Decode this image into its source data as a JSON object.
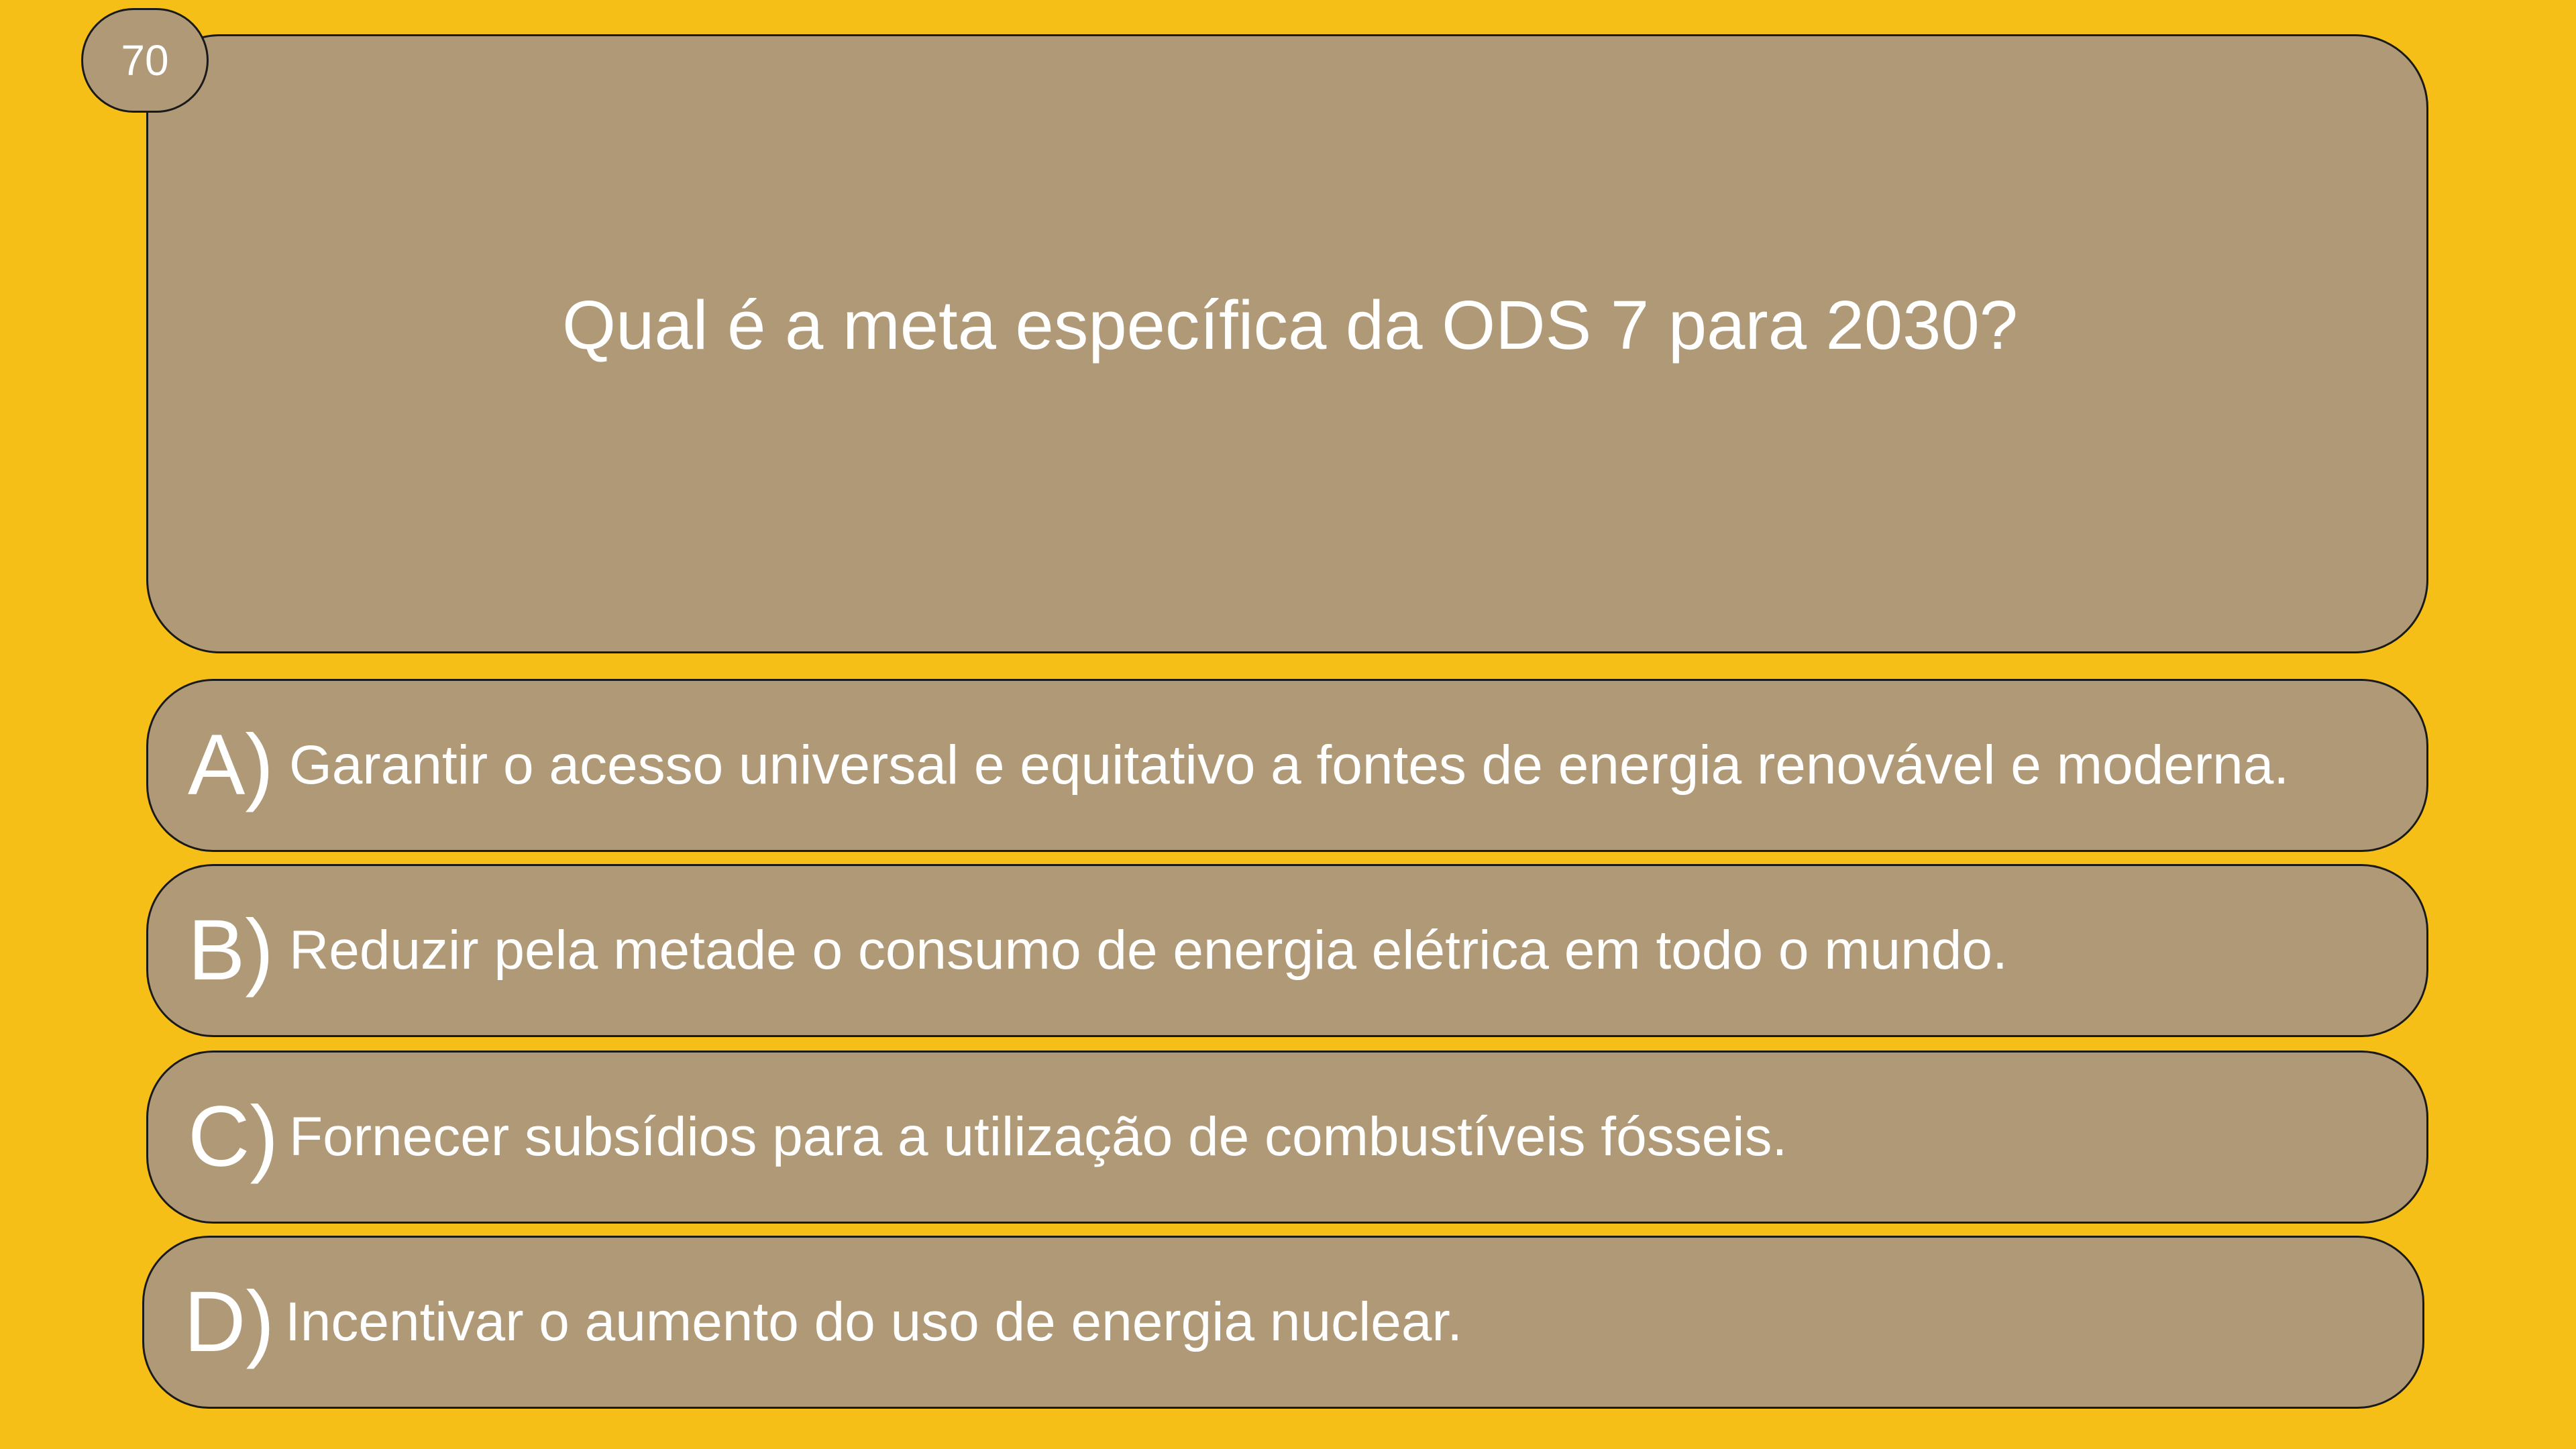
{
  "question": {
    "number": "70",
    "text": "Qual é a meta específica da ODS 7 para 2030?"
  },
  "options": [
    {
      "letter": "A)",
      "text": "Garantir o acesso universal e equitativo a fontes de energia renovável e moderna."
    },
    {
      "letter": "B)",
      "text": "Reduzir pela metade o consumo de energia elétrica em todo o mundo."
    },
    {
      "letter": "C)",
      "text": "Fornecer subsídios para a utilização de combustíveis fósseis."
    },
    {
      "letter": "D)",
      "text": "Incentivar o aumento do uso de energia nuclear."
    }
  ],
  "colors": {
    "background": "#F5BF17",
    "card": "#B09977",
    "text": "#FFFFFF",
    "border": "#1A1A1A"
  }
}
